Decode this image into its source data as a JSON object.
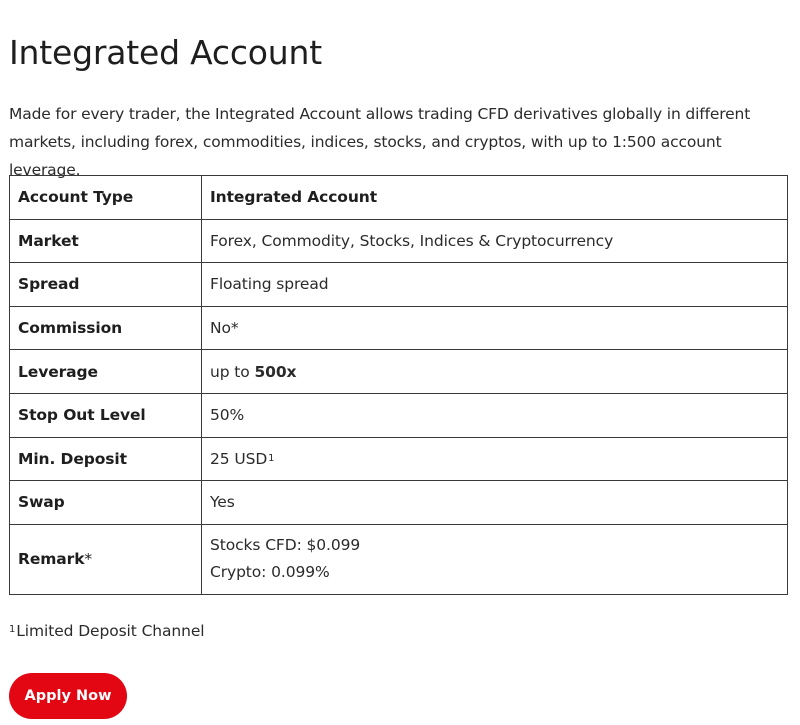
{
  "page_title": "Integrated Account",
  "intro": "Made for every trader, the Integrated Account allows trading CFD derivatives globally in different markets, including forex, commodities, indices, stocks, and cryptos, with up to 1:500 account leverage.",
  "table": {
    "header": {
      "label": "Account Type",
      "value": "Integrated Account"
    },
    "rows": [
      {
        "label": "Market",
        "value": "Forex, Commodity, Stocks, Indices & Cryptocurrency"
      },
      {
        "label": "Spread",
        "value": "Floating spread"
      },
      {
        "label": "Commission",
        "value": "No*"
      },
      {
        "label": "Leverage",
        "value_prefix": "up to ",
        "value_bold": "500x"
      },
      {
        "label": "Stop Out Level",
        "value": "50%"
      },
      {
        "label": "Min. Deposit",
        "value": "25 USD",
        "footnote_mark": "1"
      },
      {
        "label": "Swap",
        "value": "Yes"
      },
      {
        "label": "Remark",
        "label_suffix": "*",
        "lines": [
          "Stocks CFD: $0.099",
          "Crypto: 0.099%"
        ]
      }
    ]
  },
  "footnote": {
    "mark": "1",
    "text": "Limited Deposit Channel"
  },
  "apply_button": {
    "label": "Apply Now"
  },
  "colors": {
    "accent": "#e30613",
    "text": "#1e1e1e",
    "border": "#3a3a3a"
  }
}
